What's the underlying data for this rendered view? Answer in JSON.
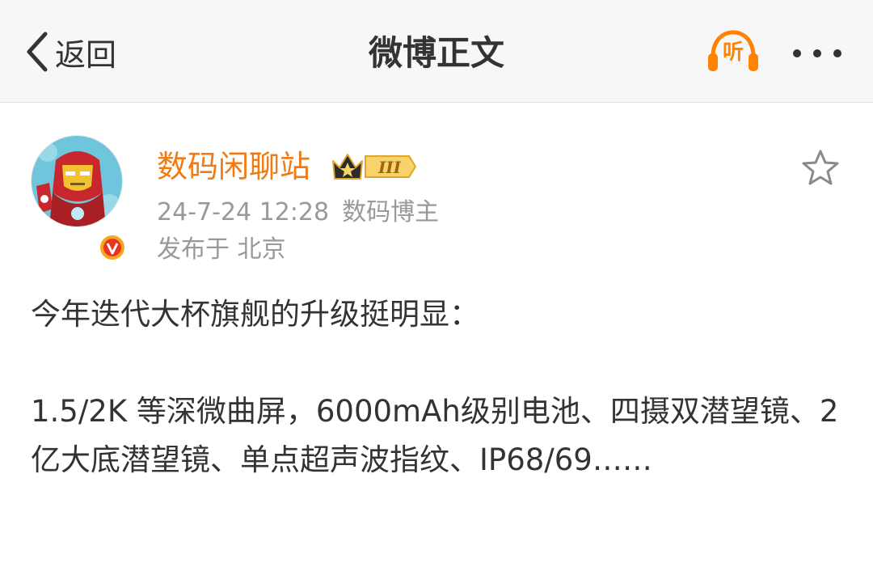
{
  "nav": {
    "back_label": "返回",
    "title": "微博正文",
    "listen_label": "听",
    "more_icon": "more-dots-icon"
  },
  "post": {
    "author": "数码闲聊站",
    "level_badge": "III",
    "timestamp": "24-7-24 12:28",
    "author_role": "数码博主",
    "location_prefix": "发布于",
    "location": "北京",
    "content_line1": "今年迭代大杯旗舰的升级挺明显：",
    "content_line2": "1.5/2K 等深微曲屏，6000mAh级别电池、四摄双潜望镜、2亿大底潜望镜、单点超声波指纹、IP68/69……"
  },
  "colors": {
    "accent_orange": "#ff8200",
    "author_orange": "#f07a14",
    "meta_gray": "#999999",
    "text": "#333333",
    "nav_bg": "#f7f7f7"
  },
  "icons": [
    "chevron-left-icon",
    "headphones-icon",
    "more-dots-icon",
    "star-outline-icon",
    "verified-v-icon",
    "crown-badge-icon"
  ]
}
